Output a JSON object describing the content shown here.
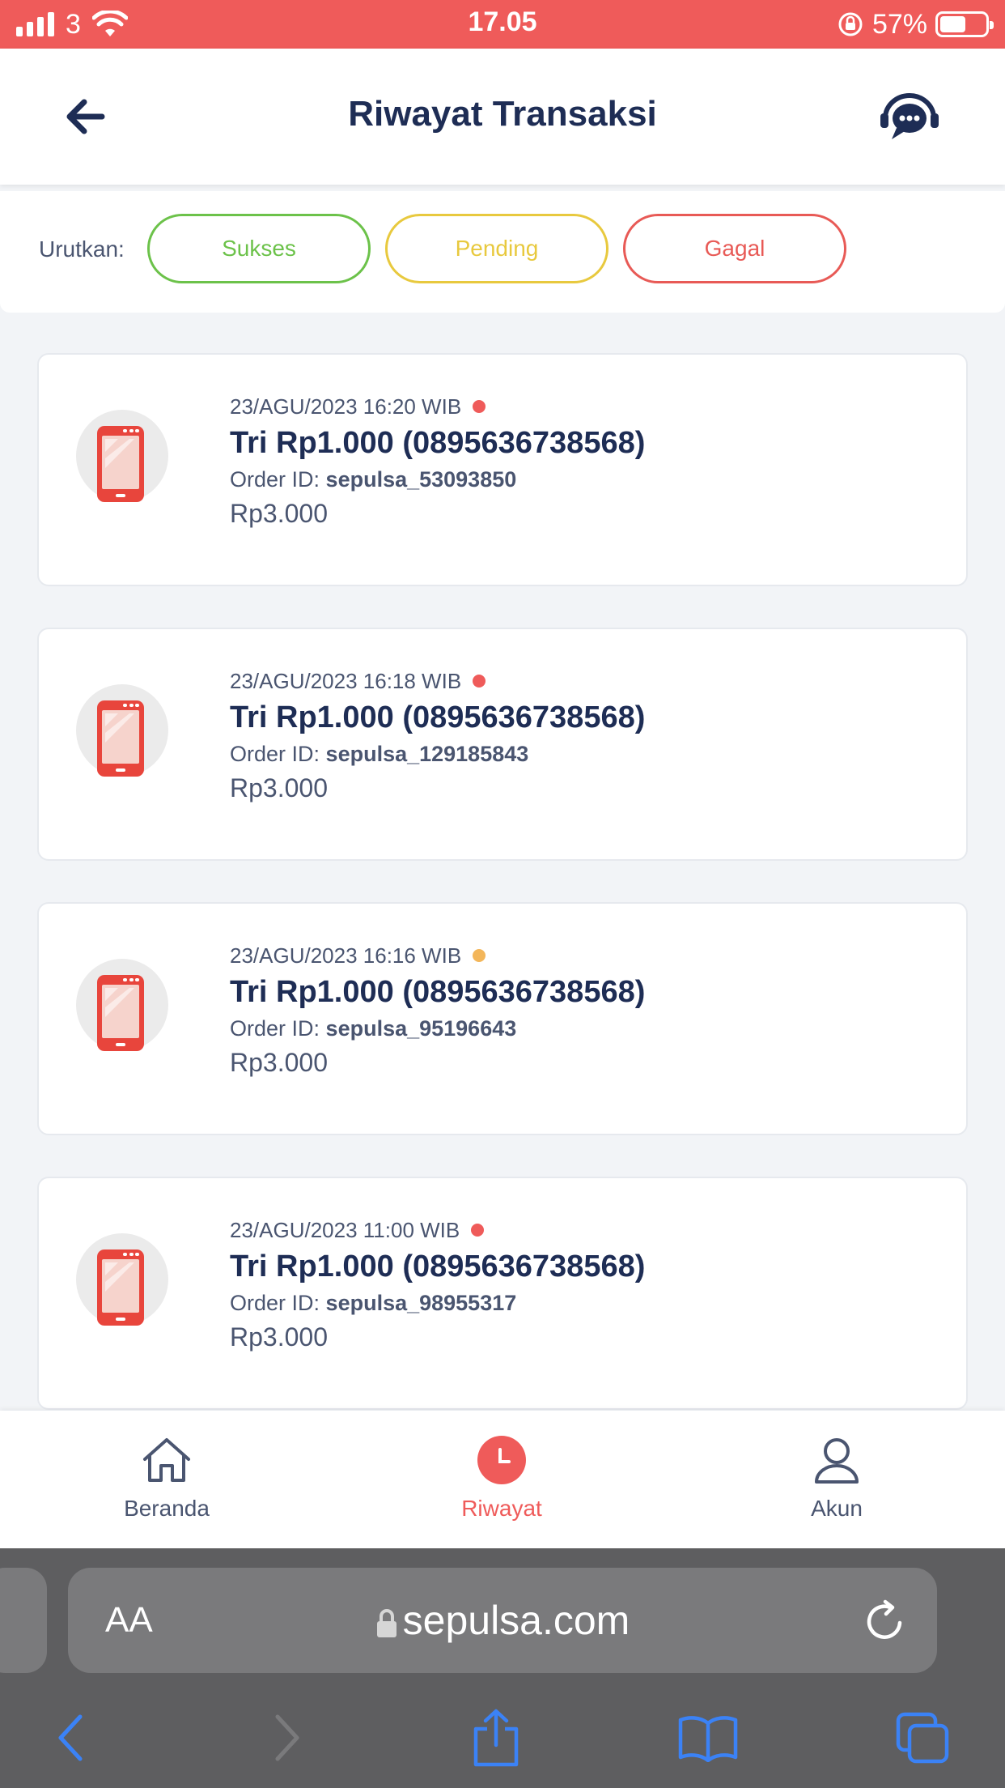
{
  "status_bar": {
    "carrier": "3",
    "time": "17.05",
    "battery": "57%",
    "battery_level": 0.57
  },
  "header": {
    "title": "Riwayat Transaksi"
  },
  "filter": {
    "label": "Urutkan:",
    "options": [
      "Sukses",
      "Pending",
      "Gagal"
    ]
  },
  "colors": {
    "accent": "#ef5b5a",
    "success": "#6cc24a",
    "pending": "#e8c93e",
    "failed": "#e85a56",
    "dot_failed": "#ef5b5a",
    "dot_pending": "#f3b65a"
  },
  "transactions": [
    {
      "date": "23/AGU/2023 16:20 WIB",
      "status": "failed",
      "title": "Tri Rp1.000 (0895636738568)",
      "order_label": "Order ID:",
      "order_id": "sepulsa_53093850",
      "price": "Rp3.000"
    },
    {
      "date": "23/AGU/2023 16:18 WIB",
      "status": "failed",
      "title": "Tri Rp1.000 (0895636738568)",
      "order_label": "Order ID:",
      "order_id": "sepulsa_129185843",
      "price": "Rp3.000"
    },
    {
      "date": "23/AGU/2023 16:16 WIB",
      "status": "pending",
      "title": "Tri Rp1.000 (0895636738568)",
      "order_label": "Order ID:",
      "order_id": "sepulsa_95196643",
      "price": "Rp3.000"
    },
    {
      "date": "23/AGU/2023 11:00 WIB",
      "status": "failed",
      "title": "Tri Rp1.000 (0895636738568)",
      "order_label": "Order ID:",
      "order_id": "sepulsa_98955317",
      "price": "Rp3.000"
    }
  ],
  "bottom_nav": {
    "items": [
      {
        "label": "Beranda",
        "icon": "home-icon"
      },
      {
        "label": "Riwayat",
        "icon": "clock-icon",
        "active": true
      },
      {
        "label": "Akun",
        "icon": "user-icon"
      }
    ]
  },
  "browser": {
    "aa_label": "AA",
    "url": "sepulsa.com"
  }
}
